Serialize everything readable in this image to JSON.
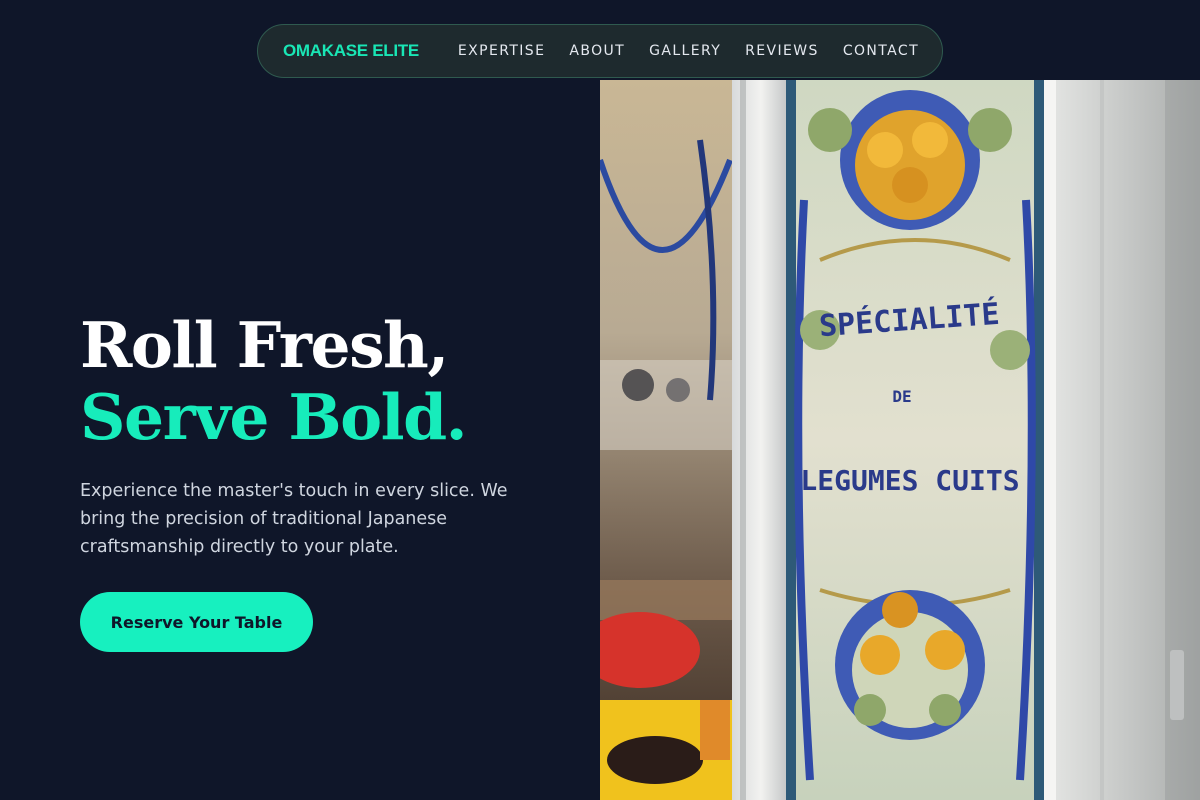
{
  "nav": {
    "brand": "OMAKASE ELITE",
    "links": [
      {
        "label": "EXPERTISE"
      },
      {
        "label": "ABOUT"
      },
      {
        "label": "GALLERY"
      },
      {
        "label": "REVIEWS"
      },
      {
        "label": "CONTACT"
      }
    ]
  },
  "hero": {
    "title_line1": "Roll Fresh,",
    "title_line2": "Serve Bold.",
    "subtitle": "Experience the master's touch in every slice. We bring the precision of traditional Japanese craftsmanship directly to your plate.",
    "cta_label": "Reserve Your Table"
  },
  "photo": {
    "sign_line1": "SPÉCIALITÉ",
    "sign_line2": "DE",
    "sign_line3": "LEGUMES CUITS"
  },
  "colors": {
    "background": "#0f1629",
    "accent": "#17f0bf",
    "nav_bg": "#1e2a2e"
  }
}
